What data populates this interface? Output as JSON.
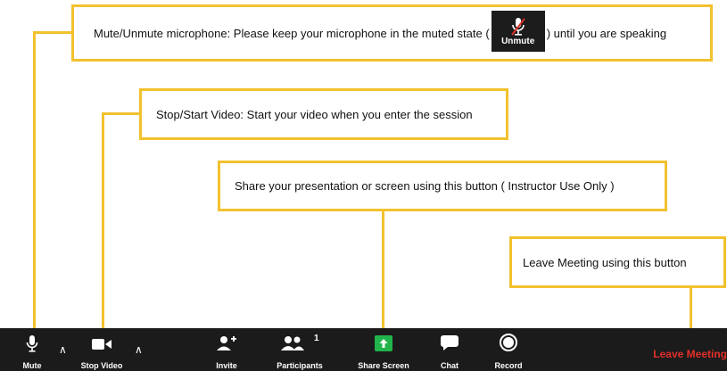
{
  "callouts": {
    "mute_text_before": "Mute/Unmute microphone:  Please keep your microphone in the muted state (",
    "mute_chip_label": "Unmute",
    "mute_text_after": ") until you are speaking",
    "video_text": "Stop/Start Video: Start your video when you enter the session",
    "share_text": "Share your presentation or screen using this button ( Instructor Use Only )",
    "leave_text": "Leave Meeting using this button"
  },
  "toolbar": {
    "mute_label": "Mute",
    "stop_video_label": "Stop Video",
    "invite_label": "Invite",
    "participants_label": "Participants",
    "participants_count": "1",
    "share_screen_label": "Share Screen",
    "chat_label": "Chat",
    "record_label": "Record",
    "leave_label": "Leave Meeting"
  },
  "colors": {
    "callout_border": "#f2c12e",
    "toolbar_bg": "#1b1b1b",
    "share_green": "#21b44a",
    "leave_red": "#e0302a"
  }
}
